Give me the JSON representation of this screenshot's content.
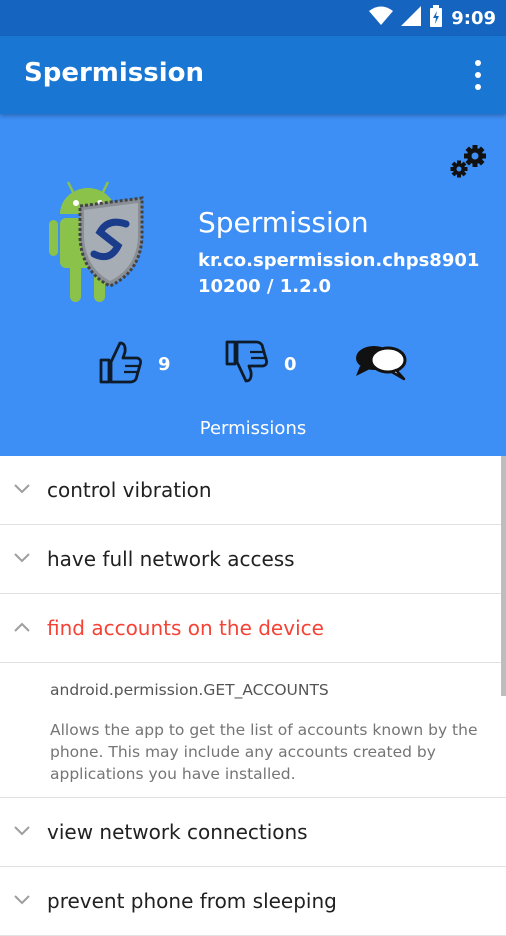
{
  "status_bar": {
    "time": "9:09",
    "icons": [
      "wifi-icon",
      "cell-signal-icon",
      "battery-charging-icon"
    ]
  },
  "app_bar": {
    "title": "Spermission",
    "overflow_icon": "more-vert-icon"
  },
  "app_info": {
    "name": "Spermission",
    "package": "kr.co.spermission.chps8901",
    "version": "10200 / 1.2.0",
    "icon": "android-shield-icon",
    "settings_icon": "gears-icon"
  },
  "actions": {
    "likes": "9",
    "dislikes": "0",
    "like_icon": "thumbs-up-icon",
    "dislike_icon": "thumbs-down-icon",
    "comment_icon": "comments-icon"
  },
  "tab": {
    "label": "Permissions"
  },
  "permissions": [
    {
      "label": "control vibration",
      "expanded": false
    },
    {
      "label": "have full network access",
      "expanded": false
    },
    {
      "label": "find accounts on the device",
      "expanded": true,
      "constant": "android.permission.GET_ACCOUNTS",
      "description": "Allows the app to get the list of accounts known by the phone. This may include any accounts created by applications you have installed."
    },
    {
      "label": "view network connections",
      "expanded": false
    },
    {
      "label": "prevent phone from sleeping",
      "expanded": false
    }
  ],
  "colors": {
    "status_bar": "#1565c0",
    "app_bar": "#1976d2",
    "header": "#3d8ef5",
    "expanded_label": "#f44336"
  }
}
